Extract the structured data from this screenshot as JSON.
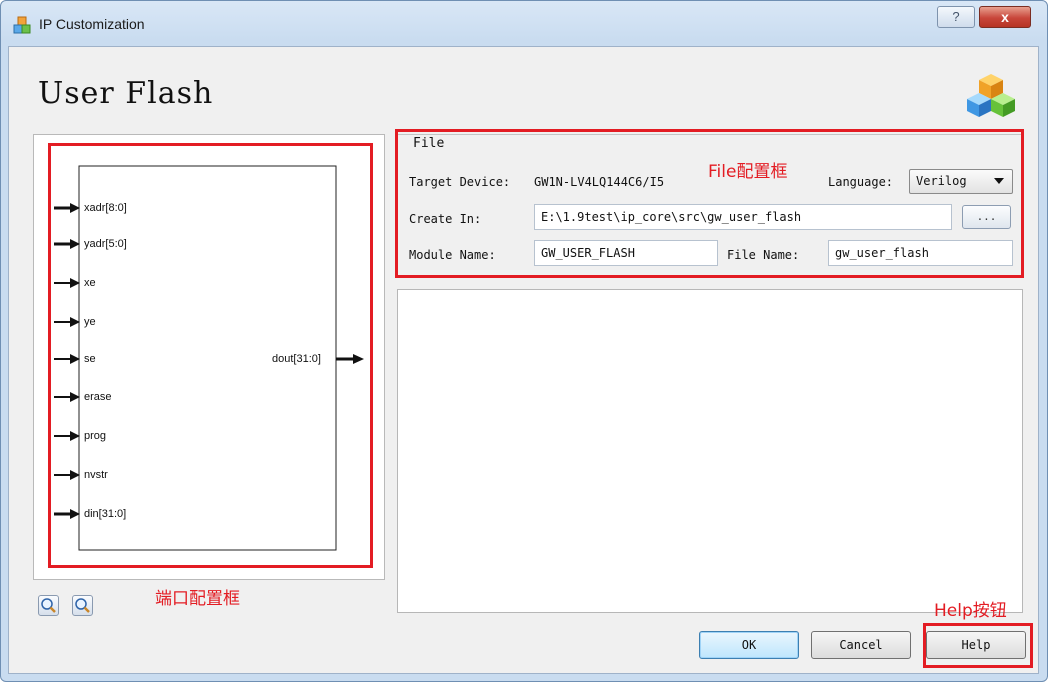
{
  "window": {
    "title": "IP Customization",
    "help_glyph": "?",
    "close_glyph": "x"
  },
  "page": {
    "title": "User Flash"
  },
  "diagram": {
    "input_ports": [
      "xadr[8:0]",
      "yadr[5:0]",
      "xe",
      "ye",
      "se",
      "erase",
      "prog",
      "nvstr",
      "din[31:0]"
    ],
    "output_ports": [
      "dout[31:0]"
    ]
  },
  "file_group": {
    "legend": "File",
    "target_device_label": "Target Device:",
    "target_device_value": "GW1N-LV4LQ144C6/I5",
    "language_label": "Language:",
    "language_value": "Verilog",
    "create_in_label": "Create In:",
    "create_in_value": "E:\\1.9test\\ip_core\\src\\gw_user_flash",
    "browse_label": "...",
    "module_name_label": "Module Name:",
    "module_name_value": "GW_USER_FLASH",
    "file_name_label": "File Name:",
    "file_name_value": "gw_user_flash"
  },
  "buttons": {
    "ok": "OK",
    "cancel": "Cancel",
    "help": "Help"
  },
  "annotations": {
    "file_box": "File配置框",
    "port_box": "端口配置框",
    "help_button": "Help按钮",
    "color": "#e31c23"
  },
  "icons": [
    "app-icon",
    "cubes-icon",
    "zoom-in-icon",
    "zoom-out-icon",
    "dropdown-arrow-icon"
  ]
}
